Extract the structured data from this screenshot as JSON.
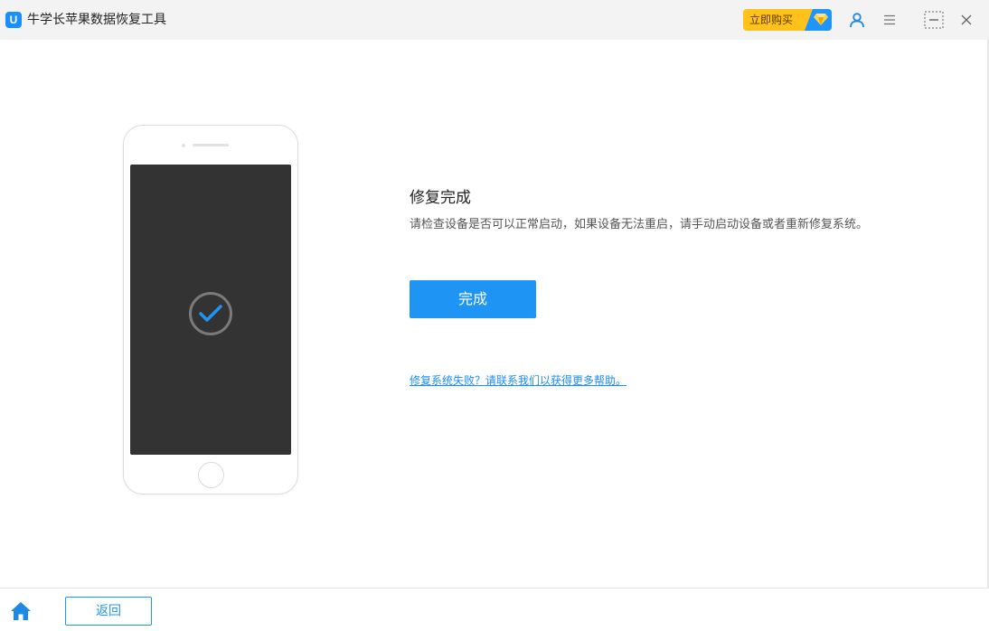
{
  "app": {
    "logo_letter": "U",
    "title": "牛学长苹果数据恢复工具"
  },
  "titlebar": {
    "buy_label": "立即购买",
    "icons": [
      "diamond-icon",
      "user-icon",
      "menu-icon",
      "minimize-icon",
      "close-icon"
    ]
  },
  "content": {
    "title": "修复完成",
    "description": "请检查设备是否可以正常启动，如果设备无法重启，请手动启动设备或者重新修复系统。",
    "done_label": "完成",
    "help_link": "修复系统失败？请联系我们以获得更多帮助。"
  },
  "footer": {
    "back_label": "返回"
  },
  "colors": {
    "accent": "#1e94f4",
    "buy_button": "#ffc21a",
    "phone_screen": "#333333",
    "titlebar_bg": "#f3f3f3"
  }
}
